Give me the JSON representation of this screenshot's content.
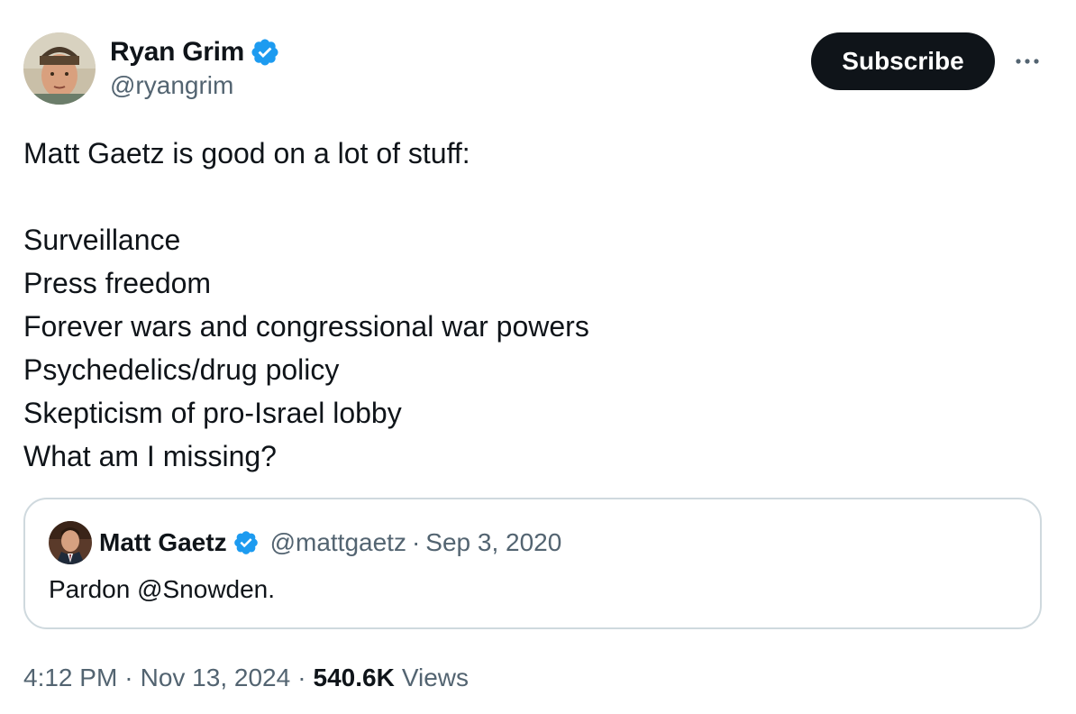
{
  "author": {
    "name": "Ryan Grim",
    "handle": "@ryangrim",
    "verified": true
  },
  "actions": {
    "subscribe_label": "Subscribe",
    "more_icon": "more-horizontal-icon"
  },
  "tweet": {
    "lines": [
      "Matt Gaetz is good on a lot of stuff:",
      "",
      "Surveillance",
      "Press freedom",
      "Forever wars and congressional war powers",
      "Psychedelics/drug policy",
      "Skepticism of pro-Israel lobby",
      "What am I missing?"
    ]
  },
  "quote": {
    "name": "Matt Gaetz",
    "handle": "@mattgaetz",
    "separator": "·",
    "date": "Sep 3, 2020",
    "text": "Pardon @Snowden.",
    "verified": true
  },
  "footer": {
    "time": "4:12 PM",
    "separator": "·",
    "date": "Nov 13, 2024",
    "views_count": "540.6K",
    "views_label": "Views"
  },
  "colors": {
    "text_primary": "#0f1419",
    "text_secondary": "#536471",
    "verified_blue": "#1d9bf0",
    "button_dark": "#0f1419",
    "border": "#cfd9de"
  }
}
